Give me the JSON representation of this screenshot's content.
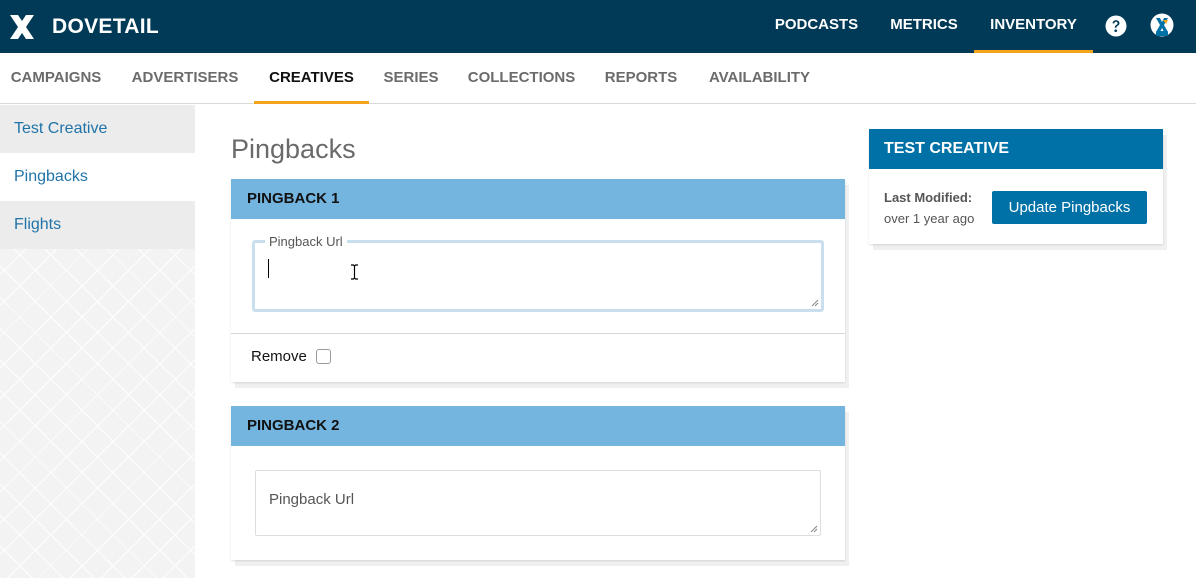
{
  "brand": {
    "name": "DOVETAIL"
  },
  "topnav": {
    "items": [
      {
        "label": "PODCASTS"
      },
      {
        "label": "METRICS"
      },
      {
        "label": "INVENTORY",
        "active": true
      }
    ],
    "help_icon": "question-circle-icon",
    "avatar_icon": "user-avatar-icon",
    "accent": "#f3a41c",
    "background": "#003a57"
  },
  "subnav": {
    "items": [
      {
        "label": "CAMPAIGNS"
      },
      {
        "label": "ADVERTISERS"
      },
      {
        "label": "CREATIVES",
        "active": true
      },
      {
        "label": "SERIES"
      },
      {
        "label": "COLLECTIONS"
      },
      {
        "label": "REPORTS"
      },
      {
        "label": "AVAILABILITY"
      }
    ]
  },
  "sidebar": {
    "items": [
      {
        "label": "Test Creative"
      },
      {
        "label": "Pingbacks",
        "active": true
      },
      {
        "label": "Flights"
      }
    ]
  },
  "main": {
    "title": "Pingbacks",
    "pingbacks": [
      {
        "header": "PINGBACK 1",
        "field_label": "Pingback Url",
        "value": "",
        "focused": true,
        "remove_label": "Remove",
        "remove_checked": false
      },
      {
        "header": "PINGBACK 2",
        "placeholder": "Pingback Url",
        "value": ""
      }
    ],
    "header_color": "#73b5df"
  },
  "summary": {
    "header": "TEST CREATIVE",
    "last_modified_label": "Last Modified:",
    "last_modified_value": "over 1 year ago",
    "update_button": "Update Pingbacks",
    "accent": "#0071a6"
  }
}
